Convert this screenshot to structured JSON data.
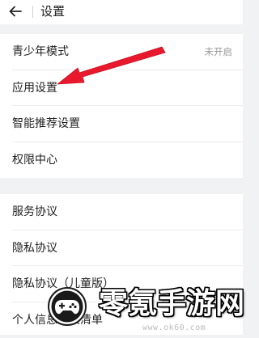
{
  "header": {
    "back_icon": "arrow-left-icon",
    "title": "设置"
  },
  "group1": {
    "items": [
      {
        "label": "青少年模式",
        "value": "未开启"
      },
      {
        "label": "应用设置"
      },
      {
        "label": "智能推荐设置"
      },
      {
        "label": "权限中心"
      }
    ]
  },
  "group2": {
    "items": [
      {
        "label": "服务协议"
      },
      {
        "label": "隐私协议"
      },
      {
        "label": "隐私协议（儿童版）"
      },
      {
        "label": "个人信息收集清单"
      }
    ]
  },
  "annotation": {
    "arrow_color": "#e8192c",
    "points_to": "应用设置"
  },
  "watermark": {
    "brand": "零氪手游网",
    "url": "www.ok60.com",
    "logo_icon": "gamepad-logo-icon"
  },
  "colors": {
    "background": "#f1f2f4",
    "surface": "#ffffff",
    "muted_text": "#9a9a9a"
  }
}
